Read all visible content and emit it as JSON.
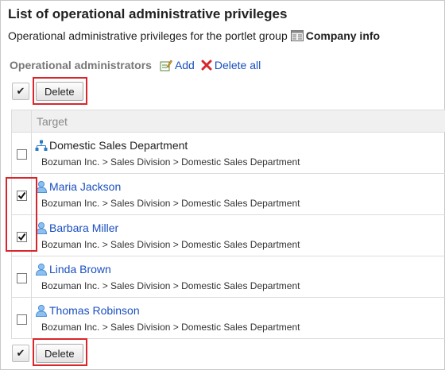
{
  "title": "List of operational administrative privileges",
  "subtitle": {
    "prefix": "Operational administrative privileges for the portlet group",
    "group_name": "Company info"
  },
  "section": {
    "label": "Operational administrators",
    "add_label": "Add",
    "delete_all_label": "Delete all"
  },
  "toolbar": {
    "select_all_mark": "✔",
    "delete_label": "Delete"
  },
  "table": {
    "header": "Target",
    "rows": [
      {
        "name": "Domestic Sales Department",
        "type": "organization",
        "path": "Bozuman Inc. > Sales Division > Domestic Sales Department",
        "checked": false
      },
      {
        "name": "Maria Jackson",
        "type": "user",
        "path": "Bozuman Inc. > Sales Division > Domestic Sales Department",
        "checked": true
      },
      {
        "name": "Barbara Miller",
        "type": "user",
        "path": "Bozuman Inc. > Sales Division > Domestic Sales Department",
        "checked": true
      },
      {
        "name": "Linda Brown",
        "type": "user",
        "path": "Bozuman Inc. > Sales Division > Domestic Sales Department",
        "checked": false
      },
      {
        "name": "Thomas Robinson",
        "type": "user",
        "path": "Bozuman Inc. > Sales Division > Domestic Sales Department",
        "checked": false
      }
    ]
  },
  "colors": {
    "link": "#1a4fbf",
    "highlight": "#d9262c",
    "user_icon": "#4a90d9",
    "org_icon": "#2a7bc8"
  }
}
